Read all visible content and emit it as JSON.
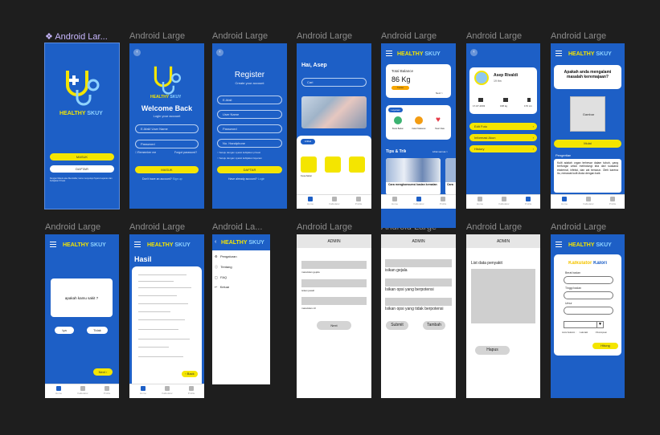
{
  "frames": {
    "label": "Android Large",
    "first_label": "Android Lar...",
    "third_label": "Android La...",
    "selected_icon": "component-diamond-icon"
  },
  "brand": {
    "part1": "HEALTHY",
    "part2": "SKUY"
  },
  "splash": {
    "login_btn": "MASUK",
    "register_btn": "DAFTAR",
    "terms": "Dengan Masuk atau Mendaftar, kamu menyetujui Syarat Layanan dan Kebijakan Privasi"
  },
  "welcome": {
    "title": "Welcome Back",
    "subtitle": "Login your account",
    "email_ph": "E-Mail/ User Name",
    "password_ph": "Password",
    "remember": "Remember me",
    "forgot": "Forgot password?",
    "login_btn": "MASUK",
    "no_account": "Don't have an account?",
    "signup": "Sign up"
  },
  "register": {
    "title": "Register",
    "subtitle": "Create your account",
    "fields": [
      "E-Mail",
      "User Name",
      "Password",
      "No. Handphone"
    ],
    "terms1": "Setuju dengan syarat kebijakan privasi",
    "terms2": "Setuju dengan syarat kebijakan layanan",
    "btn": "DAFTAR",
    "have_account": "Have already account?",
    "login": "Login"
  },
  "home": {
    "greeting": "Hai, Asep",
    "search_ph": "Cari",
    "section": "Artikel",
    "category": "Kesehatan Remaja",
    "item_label": "Kesehatan"
  },
  "balance": {
    "title": "Total Balance",
    "value": "86 Kg",
    "badge": "Tracker",
    "next": "Next >",
    "services_tag": "Layanan",
    "services": [
      "Berat Badan",
      "Kalori Makanan",
      "Heart Rate"
    ],
    "tips_title": "Tips & Trik",
    "tips_more": "Lihat semua >",
    "tip_caption": "Cara mengkonsumsi badan kemalan",
    "tip_caption2": "Cara"
  },
  "profile": {
    "name": "Asep Rivaldi",
    "age": "19 thn",
    "stats": [
      "17-07-2003",
      "168 kg",
      "170 cm"
    ],
    "menu": [
      "Edit Foto",
      "Informasi Akun",
      "History"
    ]
  },
  "quiz": {
    "question": "Apakah anda mengalami masalah keremajaan?",
    "image_label": "Gambar",
    "start": "Mulai",
    "section": "Pengertian",
    "body": "Kulit adalah organ terbesar dalam tubuh, yang berfungsi untuk melindungi kita dari suasana eksternal, infeksi, dan zat beracun. Oleh karena itu, merawat kulit Anda dengan baik"
  },
  "symptom": {
    "question": "apakah kamu sakit ?",
    "yes": "Iya",
    "no": "Tidak",
    "next": "Next"
  },
  "hasil": {
    "title": "Hasil",
    "back": "Back"
  },
  "menu": {
    "items": [
      "Pengaturan",
      "Tentang",
      "FAQ",
      "Keluar"
    ],
    "icons": [
      "gear-icon",
      "info-icon",
      "faq-icon",
      "logout-icon"
    ]
  },
  "admin": {
    "title": "ADMIN",
    "a1": {
      "labels": [
        "masukkan gejala",
        "isikan jawab",
        "masukkan ciri"
      ],
      "btn": "Next"
    },
    "a2": {
      "labels": [
        "isikan gejala",
        "Isikan opsi yang berpotensi",
        "Isikan opsi yang tidak berpotensi"
      ],
      "submit": "Submit",
      "add": "Tambah"
    },
    "a3": {
      "list_title": "List data penyakit",
      "delete": "Hapus"
    }
  },
  "calc": {
    "title1": "Kalkulator",
    "title2": "Kalori",
    "fields": [
      "Berat badan",
      "Tinggi badan",
      "Umur"
    ],
    "gender_label": "Jenis Kelamin :",
    "male": "Laki-laki",
    "female": "Perempuan",
    "btn": "Hitung"
  },
  "nav": [
    "Home",
    "Kalkulator",
    "Profile"
  ],
  "colors": {
    "primary": "#1d5fc6",
    "accent": "#f4e500",
    "canvas": "#1e1e1e"
  }
}
